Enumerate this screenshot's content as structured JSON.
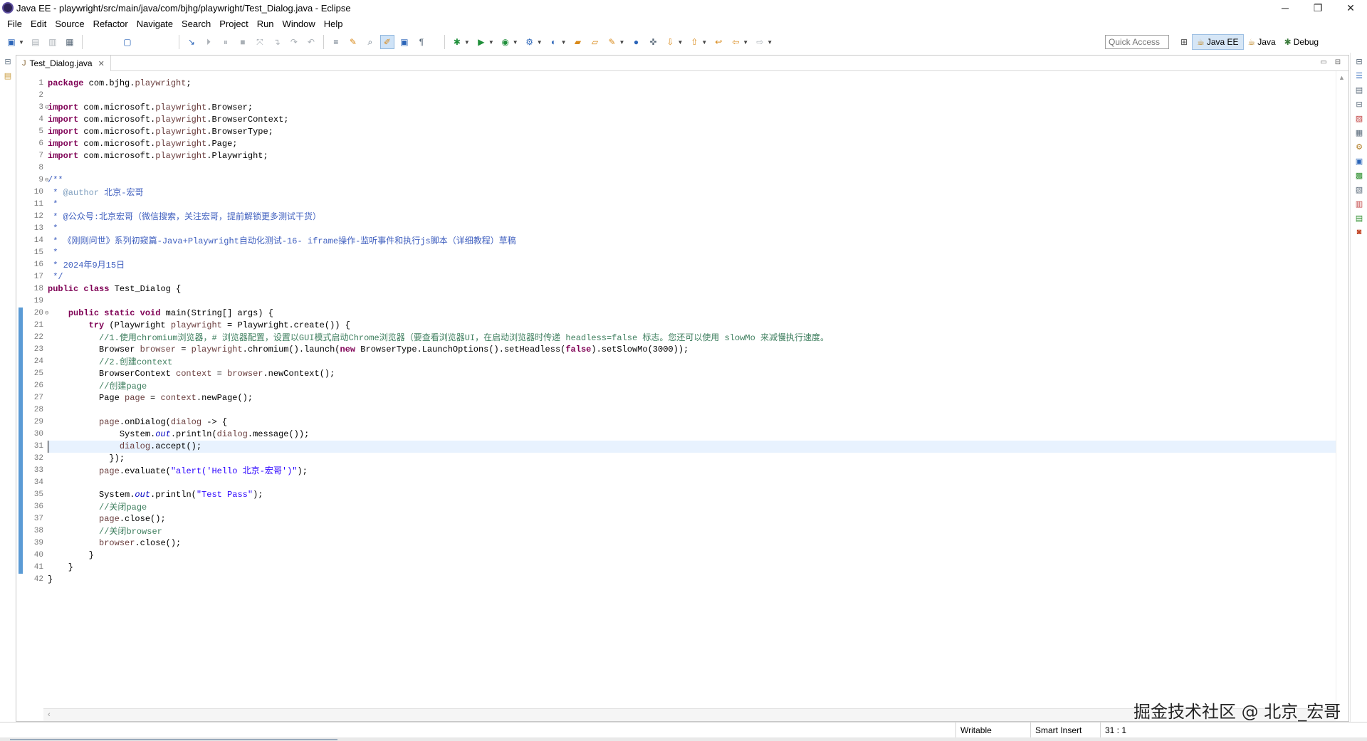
{
  "window": {
    "title": "Java EE - playwright/src/main/java/com/bjhg/playwright/Test_Dialog.java - Eclipse",
    "minimize_glyph": "─",
    "maximize_glyph": "❐",
    "close_glyph": "✕"
  },
  "menu": [
    "File",
    "Edit",
    "Source",
    "Refactor",
    "Navigate",
    "Search",
    "Project",
    "Run",
    "Window",
    "Help"
  ],
  "toolbar": {
    "quick_access_placeholder": "Quick Access"
  },
  "perspectives": [
    {
      "label": "Java EE",
      "icon": "java-ee-perspective-icon",
      "active": true
    },
    {
      "label": "Java",
      "icon": "java-perspective-icon",
      "active": false
    },
    {
      "label": "Debug",
      "icon": "bug-icon",
      "active": false
    }
  ],
  "editor": {
    "tab_label": "Test_Dialog.java",
    "tab_close": "✕",
    "caret_line": 31,
    "code_lines": [
      "package com.bjhg.playwright;",
      "",
      "import com.microsoft.playwright.Browser;",
      "import com.microsoft.playwright.BrowserContext;",
      "import com.microsoft.playwright.BrowserType;",
      "import com.microsoft.playwright.Page;",
      "import com.microsoft.playwright.Playwright;",
      "",
      "/**",
      " * @author 北京-宏哥",
      " *",
      " * @公众号:北京宏哥（微信搜索，关注宏哥，提前解锁更多测试干货）",
      " *",
      " * 《刚刚问世》系列初窥篇-Java+Playwright自动化测试-16- iframe操作-监听事件和执行js脚本（详细教程）草稿",
      " *",
      " * 2024年9月15日",
      " */",
      "public class Test_Dialog {",
      "",
      "    public static void main(String[] args) {",
      "        try (Playwright playwright = Playwright.create()) {",
      "          //1.使用chromium浏览器，# 浏览器配置，设置以GUI模式启动Chrome浏览器（要查看浏览器UI，在启动浏览器时传递 headless=false 标志。您还可以使用 slowMo 来减慢执行速度。",
      "          Browser browser = playwright.chromium().launch(new BrowserType.LaunchOptions().setHeadless(false).setSlowMo(3000));",
      "          //2.创建context",
      "          BrowserContext context = browser.newContext();",
      "          //创建page",
      "          Page page = context.newPage();",
      "",
      "          page.onDialog(dialog -> {",
      "              System.out.println(dialog.message());",
      "              dialog.accept();",
      "            });",
      "          page.evaluate(\"alert('Hello 北京-宏哥')\");",
      "",
      "          System.out.println(\"Test Pass\");",
      "          //关闭page",
      "          page.close();",
      "          //关闭browser",
      "          browser.close();",
      "        }",
      "    }",
      "}"
    ]
  },
  "status": {
    "writable": "Writable",
    "insert_mode": "Smart Insert",
    "position": "31 : 1"
  },
  "watermark": "掘金技术社区 @ 北京_宏哥",
  "colors": {
    "keyword": "#7f0055",
    "comment": "#3f7f5f",
    "javadoc": "#3f5fbf",
    "string": "#2a00ff",
    "change_bar": "#5b9bd5",
    "current_line": "#e8f2fe"
  }
}
